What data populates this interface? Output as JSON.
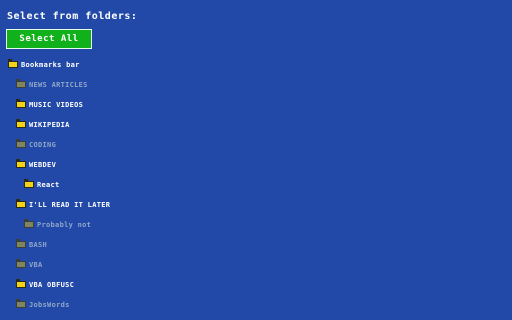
{
  "header": {
    "title": "Select from folders:"
  },
  "actions": {
    "select_all_label": "Select All"
  },
  "colors": {
    "background": "#2249a8",
    "select_all_button": "#11b11b",
    "folder_selected": "#f2d21a",
    "folder_unselected": "#7f8560",
    "label_selected": "#ffffff",
    "label_unselected": "#8fa6c9"
  },
  "folders": [
    {
      "label": "Bookmarks bar",
      "depth": 0,
      "selected": true,
      "icon": "folder-icon"
    },
    {
      "label": "NEWS ARTICLES",
      "depth": 1,
      "selected": false,
      "icon": "folder-icon"
    },
    {
      "label": "MUSIC VIDEOS",
      "depth": 1,
      "selected": true,
      "icon": "folder-icon"
    },
    {
      "label": "WIKIPEDIA",
      "depth": 1,
      "selected": true,
      "icon": "folder-icon"
    },
    {
      "label": "CODING",
      "depth": 1,
      "selected": false,
      "icon": "folder-icon"
    },
    {
      "label": "WEBDEV",
      "depth": 1,
      "selected": true,
      "icon": "folder-icon"
    },
    {
      "label": "React",
      "depth": 2,
      "selected": true,
      "icon": "folder-icon"
    },
    {
      "label": "I'LL READ IT LATER",
      "depth": 1,
      "selected": true,
      "icon": "folder-icon"
    },
    {
      "label": "Probably not",
      "depth": 2,
      "selected": false,
      "icon": "folder-icon"
    },
    {
      "label": "BASH",
      "depth": 1,
      "selected": false,
      "icon": "folder-icon"
    },
    {
      "label": "VBA",
      "depth": 1,
      "selected": false,
      "icon": "folder-icon"
    },
    {
      "label": "VBA OBFUSC",
      "depth": 1,
      "selected": true,
      "icon": "folder-icon"
    },
    {
      "label": "JobsWords",
      "depth": 1,
      "selected": false,
      "icon": "folder-icon"
    }
  ]
}
